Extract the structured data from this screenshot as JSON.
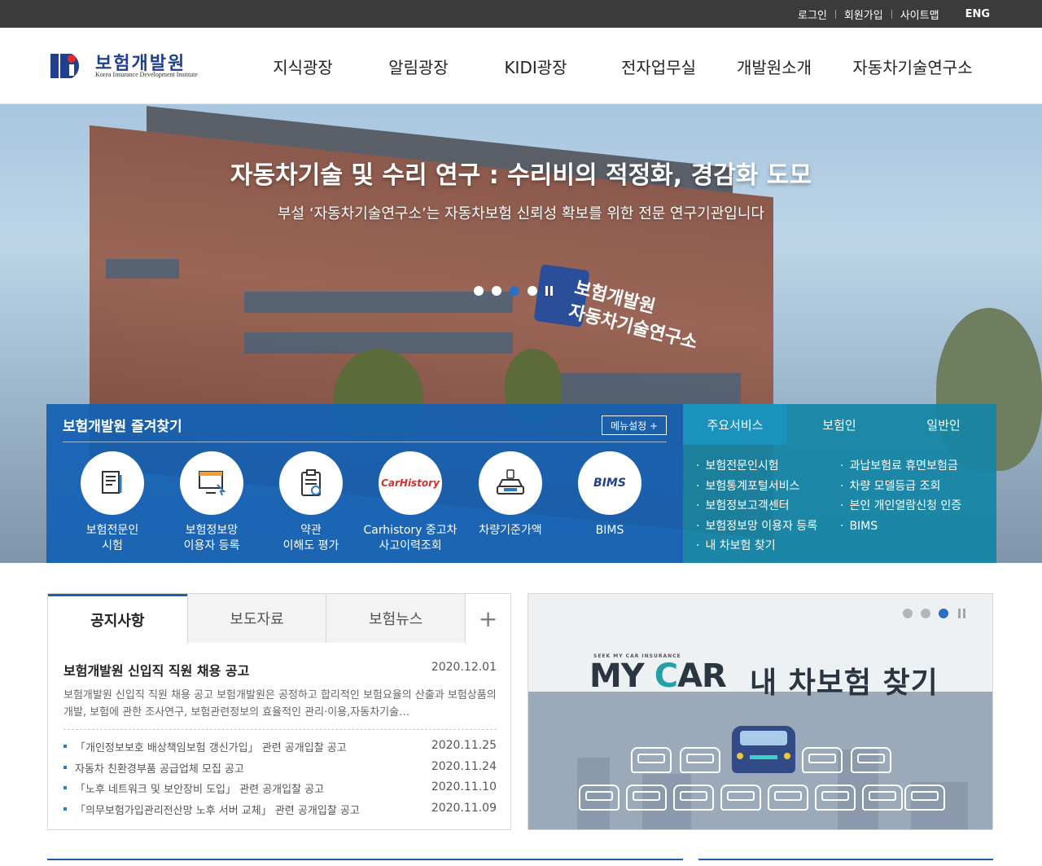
{
  "utility": {
    "login": "로그인",
    "join": "회원가입",
    "sitemap": "사이트맵",
    "eng": "ENG"
  },
  "logo": {
    "name": "보험개발원",
    "english": "Korea Insurance Development Institute"
  },
  "nav": [
    "지식광장",
    "알림광장",
    "KIDI광장",
    "전자업무실",
    "개발원소개",
    "자동차기술연구소"
  ],
  "hero": {
    "title": "자동차기술 및 수리 연구 : 수리비의 적정화, 경감화 도모",
    "subtitle": "부설 ‘자동차기술연구소’는 자동차보험 신뢰성 확보를 위한 전문 연구기관입니다",
    "sign_line1": "보험개발원",
    "sign_line2": "자동차기술연구소",
    "slide_count": 4,
    "active_slide": 3
  },
  "favorites": {
    "title": "보험개발원 즐겨찾기",
    "menu_setting": "메뉴설정 +",
    "items": [
      {
        "line1": "보험전문인",
        "line2": "시험",
        "icon": "document-edit-icon"
      },
      {
        "line1": "보험정보망",
        "line2": "이용자 등록",
        "icon": "monitor-cursor-icon"
      },
      {
        "line1": "약관",
        "line2": "이해도 평가",
        "icon": "checklist-icon"
      },
      {
        "line1": "Carhistory 중고차",
        "line2": "사고이력조회",
        "icon": "carhistory-logo",
        "logo_text": "CarHistory"
      },
      {
        "line1": "차량기준가액",
        "line2": "",
        "icon": "car-front-icon"
      },
      {
        "line1": "BIMS",
        "line2": "",
        "icon": "bims-logo",
        "logo_text": "BIMS"
      }
    ]
  },
  "services": {
    "tabs": [
      "주요서비스",
      "보험인",
      "일반인"
    ],
    "left": [
      "보험전문인시험",
      "보험통계포털서비스",
      "보험정보고객센터",
      "보험정보망 이용자 등록",
      "내 차보험 찾기"
    ],
    "right": [
      "과납보험료 휴면보험금",
      "차량 모델등급 조회",
      "본인 개인열람신청 인증",
      "BIMS"
    ]
  },
  "notice": {
    "tabs": [
      "공지사항",
      "보도자료",
      "보험뉴스"
    ],
    "more": "+",
    "headline": {
      "title": "보험개발원 신입직 직원 채용 공고",
      "date": "2020.12.01"
    },
    "summary": "보험개발원 신입직 직원 채용 공고 보험개발원은 공정하고 합리적인 보험요율의 산출과 보험상품의개발, 보험에 관한 조사연구, 보험관련정보의 효율적인 관리·이용,자동차기술…",
    "items": [
      {
        "title": "「개인정보보호 배상책임보험 갱신가입」 관련 공개입찰 공고",
        "date": "2020.11.25"
      },
      {
        "title": "자동차 친환경부품 공급업체 모집 공고",
        "date": "2020.11.24"
      },
      {
        "title": "「노후 네트워크 및 보안장비 도입」 관련 공개입찰 공고",
        "date": "2020.11.10"
      },
      {
        "title": "「의무보험가입관리전산망 노후 서버 교체」 관련 공개입찰 공고",
        "date": "2020.11.09"
      }
    ]
  },
  "mycar": {
    "small": "SEEK MY CAR INSURANCE",
    "logo_my": "MY ",
    "logo_c": "C",
    "logo_ar": "AR",
    "title": "내 차보험 찾기",
    "slide_count": 3,
    "active_slide": 3
  },
  "colors": {
    "brand": "#1b5faa",
    "favorites_bg": "#1361b4",
    "services_bg": "#1484a5",
    "highlight": "#ee0000"
  }
}
